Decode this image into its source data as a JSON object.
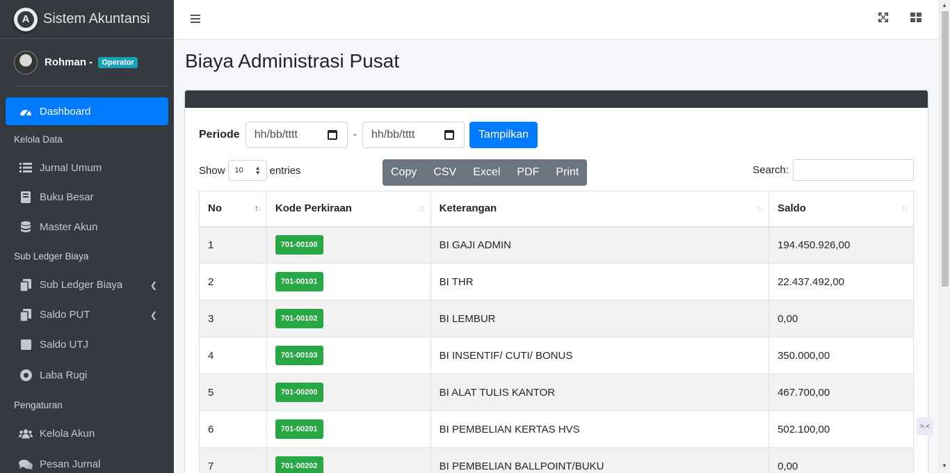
{
  "app": {
    "title": "Sistem Akuntansi",
    "logo_letter": "A"
  },
  "user": {
    "name": "Rohman -",
    "role": "Operator"
  },
  "sidebar": {
    "dashboard": {
      "label": "Dashboard",
      "icon": "tachometer-icon"
    },
    "section_kelola": "Kelola Data",
    "jurnal_umum": "Jurnal Umum",
    "buku_besar": "Buku Besar",
    "master_akun": "Master Akun",
    "section_subledger": "Sub Ledger Biaya",
    "sub_ledger_biaya": "Sub Ledger Biaya",
    "saldo_put": "Saldo PUT",
    "saldo_utj": "Saldo UTJ",
    "laba_rugi": "Laba Rugi",
    "section_pengaturan": "Pengaturan",
    "kelola_akun": "Kelola Akun",
    "pesan_jurnal": "Pesan Jurnal"
  },
  "page": {
    "title": "Biaya Administrasi Pusat"
  },
  "filter": {
    "label": "Periode",
    "date_from": "hh/bb/tttt",
    "separator": "-",
    "date_to": "hh/bb/tttt",
    "submit": "Tampilkan"
  },
  "table_controls": {
    "show": "Show",
    "length": "10",
    "entries": "entries",
    "buttons": [
      "Copy",
      "CSV",
      "Excel",
      "PDF",
      "Print"
    ],
    "search_label": "Search:"
  },
  "table": {
    "headers": [
      "No",
      "Kode Perkiraan",
      "Keterangan",
      "Saldo"
    ],
    "rows": [
      {
        "no": "1",
        "kode": "701-00100",
        "ket": "BI GAJI ADMIN",
        "saldo": "194.450.926,00"
      },
      {
        "no": "2",
        "kode": "701-00101",
        "ket": "BI THR",
        "saldo": "22.437.492,00"
      },
      {
        "no": "3",
        "kode": "701-00102",
        "ket": "BI LEMBUR",
        "saldo": "0,00"
      },
      {
        "no": "4",
        "kode": "701-00103",
        "ket": "BI INSENTIF/ CUTI/ BONUS",
        "saldo": "350.000,00"
      },
      {
        "no": "5",
        "kode": "701-00200",
        "ket": "BI ALAT TULIS KANTOR",
        "saldo": "467.700,00"
      },
      {
        "no": "6",
        "kode": "701-00201",
        "ket": "BI PEMBELIAN KERTAS HVS",
        "saldo": "502.100,00"
      },
      {
        "no": "7",
        "kode": "701-00202",
        "ket": "BI PEMBELIAN BALLPOINT/BUKU",
        "saldo": "0,00"
      }
    ]
  },
  "colors": {
    "sidebar": "#343a40",
    "primary": "#007bff",
    "success": "#28a745",
    "info": "#17a2b8",
    "secondary": "#6c757d"
  }
}
